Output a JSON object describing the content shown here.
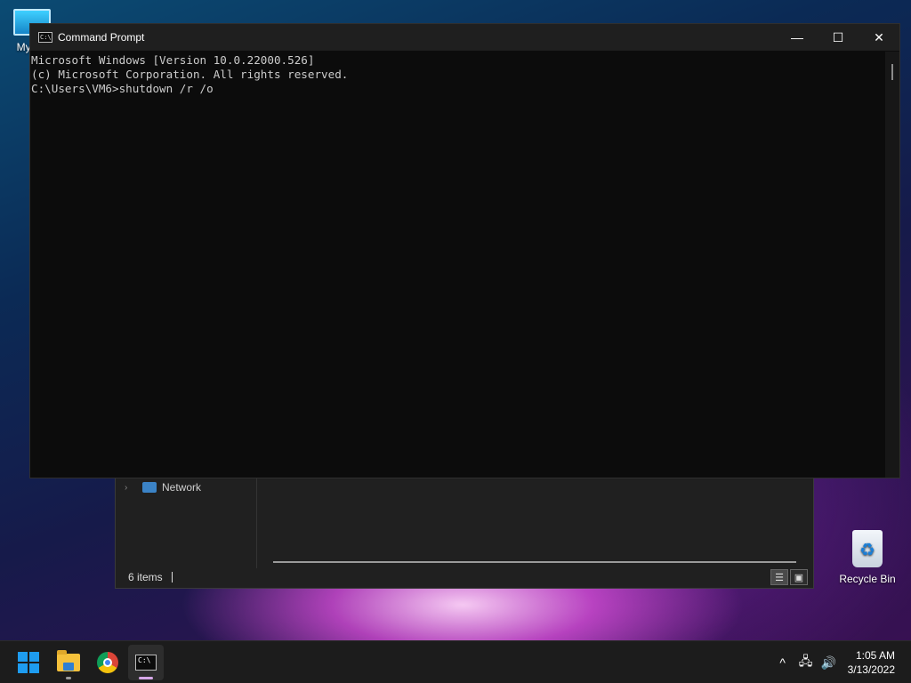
{
  "desktop": {
    "icons": [
      {
        "label": "My Co",
        "icon": "computer-icon"
      },
      {
        "label": "Recycle Bin",
        "icon": "recycle-bin-icon"
      }
    ]
  },
  "explorer": {
    "nav_item": "Network",
    "status": "6 items"
  },
  "cmd": {
    "title": "Command Prompt",
    "lines": [
      "Microsoft Windows [Version 10.0.22000.526]",
      "(c) Microsoft Corporation. All rights reserved.",
      "",
      "C:\\Users\\VM6>shutdown /r /o"
    ],
    "controls": {
      "minimize": "—",
      "maximize": "☐",
      "close": "✕"
    }
  },
  "taskbar": {
    "apps": [
      {
        "name": "start",
        "icon": "windows-logo-icon"
      },
      {
        "name": "file-explorer",
        "icon": "folder-icon"
      },
      {
        "name": "chrome",
        "icon": "chrome-icon"
      },
      {
        "name": "command-prompt",
        "icon": "terminal-icon"
      }
    ],
    "tray": {
      "chevron": "^",
      "network": "🖧",
      "volume": "🔊",
      "time": "1:05 AM",
      "date": "3/13/2022"
    }
  },
  "colors": {
    "console_bg": "#0c0c0c",
    "console_text": "#cccccc",
    "taskbar_bg": "#1c1c1c",
    "accent": "#1e9cf0"
  }
}
